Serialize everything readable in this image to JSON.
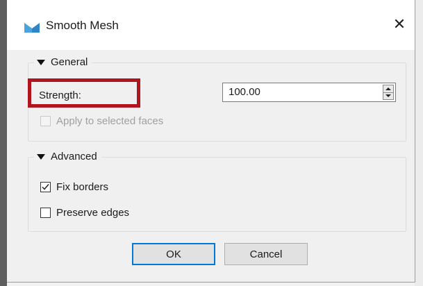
{
  "window": {
    "title": "Smooth Mesh",
    "close_glyph": "✕",
    "icon": "mesh-app-icon"
  },
  "general": {
    "header": "General",
    "strength_label": "Strength:",
    "strength_value": "100.00",
    "apply_selected_label": "Apply to selected faces",
    "apply_selected_checked": false,
    "apply_selected_enabled": false
  },
  "advanced": {
    "header": "Advanced",
    "fix_borders_label": "Fix borders",
    "fix_borders_checked": true,
    "preserve_edges_label": "Preserve edges",
    "preserve_edges_checked": false
  },
  "buttons": {
    "ok": "OK",
    "cancel": "Cancel"
  },
  "colors": {
    "highlight": "#b0141c",
    "default_button_border": "#0078d7"
  }
}
